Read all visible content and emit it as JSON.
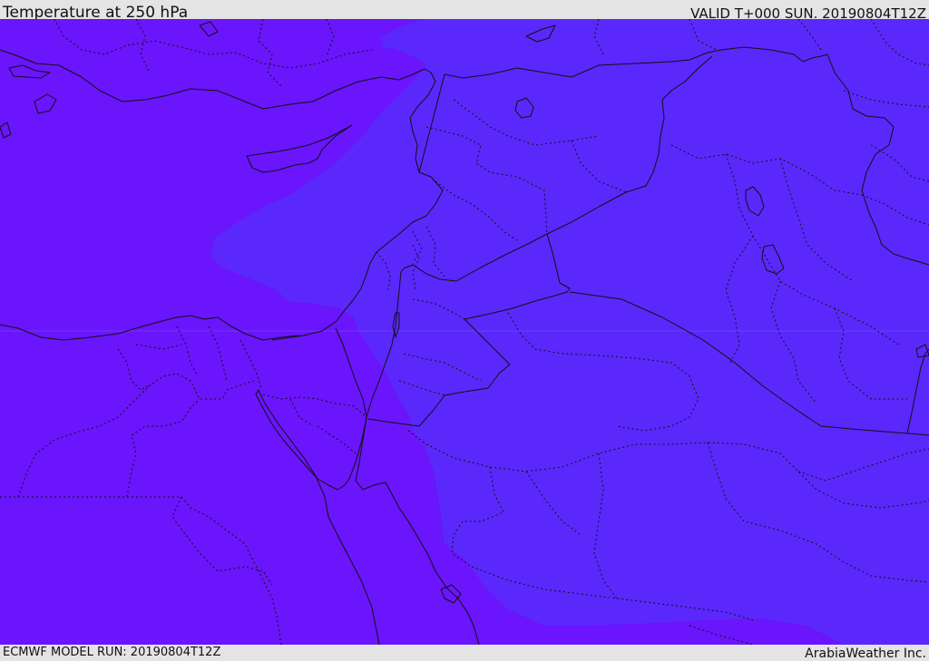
{
  "header": {
    "title": "Temperature at 250 hPa",
    "valid": "VALID T+000 SUN. 20190804T12Z"
  },
  "footer": {
    "model_run": "ECMWF MODEL RUN: 20190804T12Z",
    "credit": "ArabiaWeather Inc."
  },
  "map": {
    "field": "temperature",
    "level": "250 hPa",
    "region": "Eastern Mediterranean / Middle East",
    "colors": {
      "cold_zone": "#6a15fb",
      "warm_zone": "#5a28fb",
      "border": "#111111"
    }
  }
}
